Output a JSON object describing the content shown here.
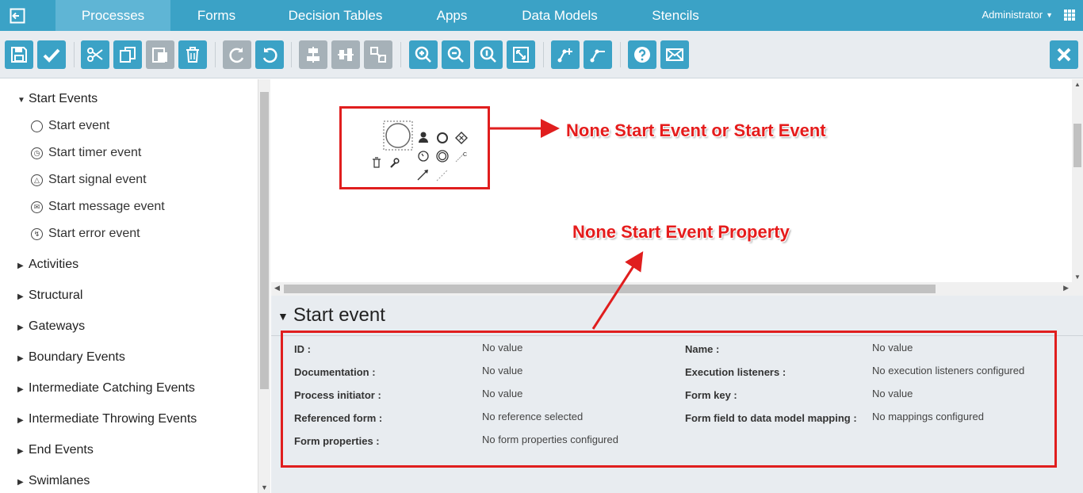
{
  "nav": {
    "tabs": [
      {
        "label": "Processes",
        "active": true
      },
      {
        "label": "Forms"
      },
      {
        "label": "Decision Tables"
      },
      {
        "label": "Apps"
      },
      {
        "label": "Data Models"
      },
      {
        "label": "Stencils"
      }
    ],
    "user": "Administrator"
  },
  "toolbar": {
    "buttons": [
      "save-icon",
      "validate-icon",
      "cut-icon",
      "copy-icon",
      "paste-icon",
      "delete-icon",
      "redo-icon",
      "undo-icon",
      "align-vertical-icon",
      "align-horizontal-icon",
      "same-size-icon",
      "zoom-in-icon",
      "zoom-out-icon",
      "zoom-actual-icon",
      "zoom-fit-icon",
      "bendpoint-add-icon",
      "bendpoint-remove-icon",
      "help-icon",
      "feedback-icon",
      "close-icon"
    ],
    "accent": "#3ba2c6",
    "disabled_color": "#a6b1b8"
  },
  "palette": {
    "open_group": "Start Events",
    "items": [
      "Start event",
      "Start timer event",
      "Start signal event",
      "Start message event",
      "Start error event"
    ],
    "groups": [
      "Activities",
      "Structural",
      "Gateways",
      "Boundary Events",
      "Intermediate Catching Events",
      "Intermediate Throwing Events",
      "End Events",
      "Swimlanes"
    ]
  },
  "properties": {
    "title": "Start event",
    "left": [
      {
        "label": "ID :",
        "value": "No value"
      },
      {
        "label": "Documentation :",
        "value": "No value"
      },
      {
        "label": "Process initiator :",
        "value": "No value"
      },
      {
        "label": "Referenced form :",
        "value": "No reference selected"
      },
      {
        "label": "Form properties :",
        "value": "No form properties configured"
      }
    ],
    "right": [
      {
        "label": "Name :",
        "value": "No value"
      },
      {
        "label": "Execution listeners :",
        "value": "No execution listeners configured"
      },
      {
        "label": "Form key :",
        "value": "No value"
      },
      {
        "label": "Form field to data model mapping :",
        "value": "No mappings configured"
      }
    ]
  },
  "annotations": {
    "start_event": "None Start Event  or  Start Event",
    "property": "None Start Event Property",
    "color": "#e01e1e"
  }
}
